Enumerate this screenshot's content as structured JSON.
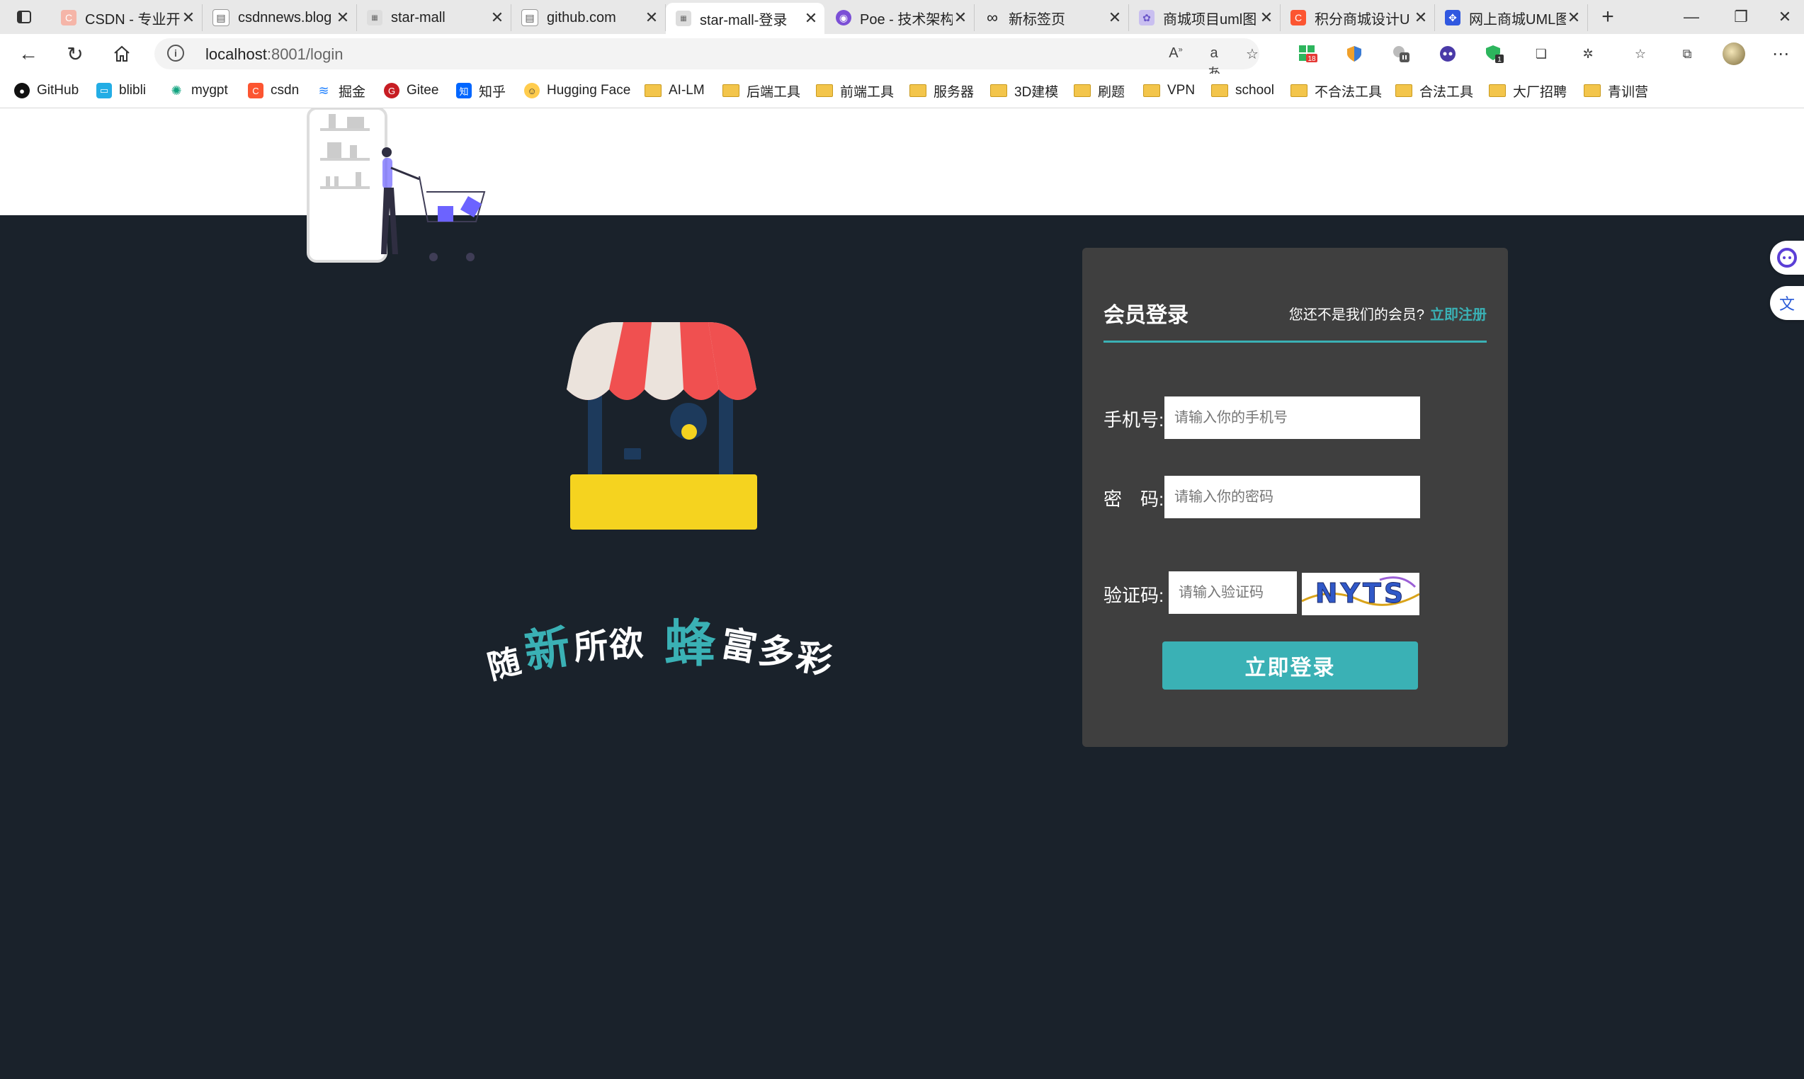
{
  "browser": {
    "tabs": [
      {
        "title": "CSDN - 专业开",
        "favicon": "csdn-icon",
        "color": "#fc5531"
      },
      {
        "title": "csdnnews.blog",
        "favicon": "page-icon",
        "color": "#9aa0a6"
      },
      {
        "title": "star-mall",
        "favicon": "star-mall-icon",
        "color": "#888"
      },
      {
        "title": "github.com",
        "favicon": "page-icon",
        "color": "#9aa0a6"
      },
      {
        "title": "star-mall-登录",
        "favicon": "star-mall-icon",
        "color": "#888",
        "active": true
      },
      {
        "title": "Poe - 技术架构",
        "favicon": "poe-icon",
        "color": "#7b4fd6"
      },
      {
        "title": "新标签页",
        "favicon": "infinity-icon",
        "color": "#222"
      },
      {
        "title": "商城项目uml图",
        "favicon": "diagram-icon",
        "color": "#8a79d8"
      },
      {
        "title": "积分商城设计U",
        "favicon": "csdn-icon",
        "color": "#fc5531"
      },
      {
        "title": "网上商城UML图",
        "favicon": "baidu-icon",
        "color": "#3058e0"
      }
    ],
    "new_tab": "+",
    "window_controls": {
      "minimize": "—",
      "restore": "❐",
      "close": "✕"
    },
    "address": {
      "host": "localhost",
      "path": ":8001/login"
    },
    "bookmarks": [
      {
        "label": "GitHub",
        "icon": "github-icon",
        "color": "#111"
      },
      {
        "label": "blibli",
        "icon": "bilibili-icon",
        "color": "#23ade5"
      },
      {
        "label": "mygpt",
        "icon": "openai-icon",
        "color": "#10a37f"
      },
      {
        "label": "csdn",
        "icon": "csdn-icon",
        "color": "#fc5531"
      },
      {
        "label": "掘金",
        "icon": "juejin-icon",
        "color": "#1e80ff"
      },
      {
        "label": "Gitee",
        "icon": "gitee-icon",
        "color": "#c71d23"
      },
      {
        "label": "知乎",
        "icon": "zhihu-icon",
        "color": "#0066ff"
      },
      {
        "label": "Hugging Face",
        "icon": "huggingface-icon",
        "color": "#ffcc4d"
      },
      {
        "label": "AI-LM",
        "icon": "folder-icon"
      },
      {
        "label": "后端工具",
        "icon": "folder-icon"
      },
      {
        "label": "前端工具",
        "icon": "folder-icon"
      },
      {
        "label": "服务器",
        "icon": "folder-icon"
      },
      {
        "label": "3D建模",
        "icon": "folder-icon"
      },
      {
        "label": "刷题",
        "icon": "folder-icon"
      },
      {
        "label": "VPN",
        "icon": "folder-icon"
      },
      {
        "label": "school",
        "icon": "folder-icon"
      },
      {
        "label": "不合法工具",
        "icon": "folder-icon"
      },
      {
        "label": "合法工具",
        "icon": "folder-icon"
      },
      {
        "label": "大厂招聘",
        "icon": "folder-icon"
      },
      {
        "label": "青训营",
        "icon": "folder-icon"
      }
    ],
    "extension_badges": {
      "first": "18",
      "second": "1"
    }
  },
  "page": {
    "slogan": [
      "随",
      "新",
      "所欲",
      "蜂",
      "富多彩"
    ],
    "accent_color": "#3ab1b5",
    "login": {
      "title": "会员登录",
      "register_prompt": "您还不是我们的会员?",
      "register_link": "立即注册",
      "phone_label": "手机号:",
      "phone_placeholder": "请输入你的手机号",
      "password_label": "密　码:",
      "password_placeholder": "请输入你的密码",
      "captcha_label": "验证码:",
      "captcha_placeholder": "请输入验证码",
      "captcha_text": "NYTS",
      "submit_label": "立即登录"
    }
  }
}
